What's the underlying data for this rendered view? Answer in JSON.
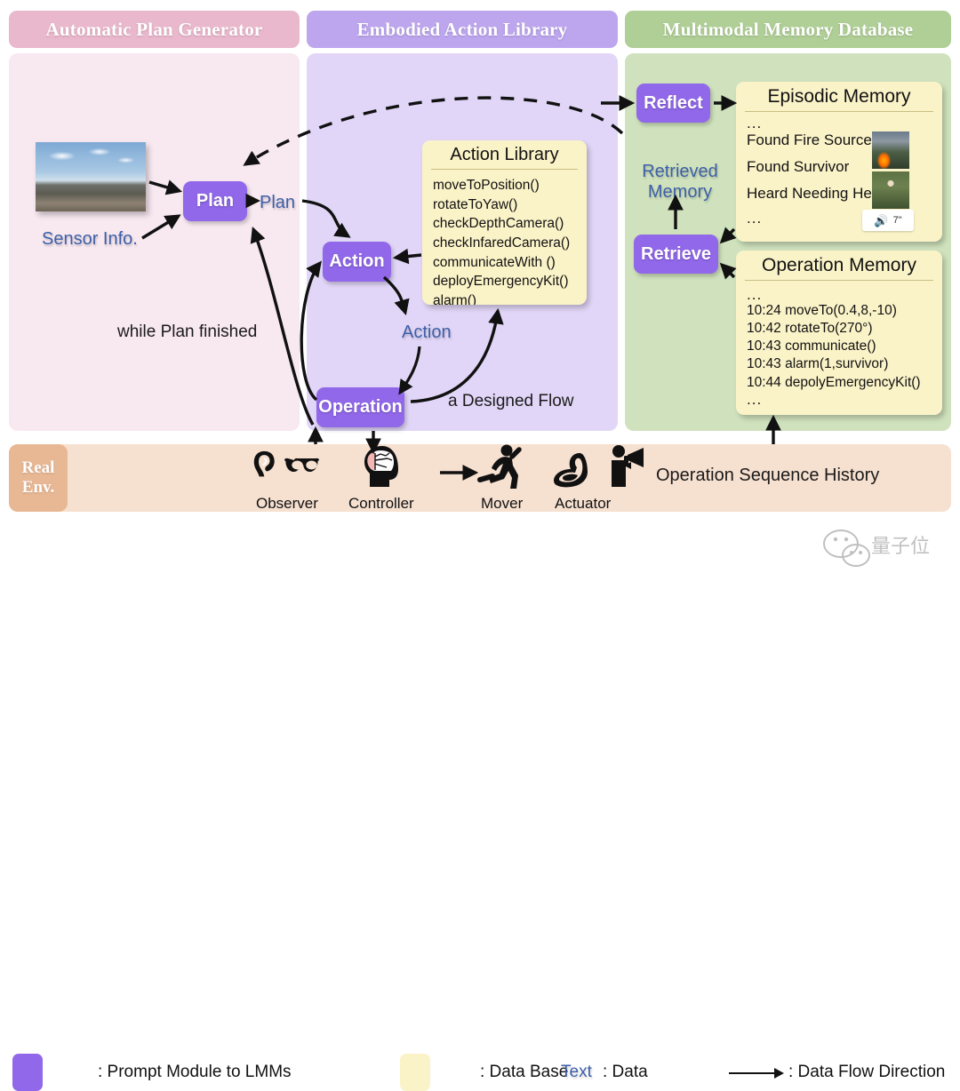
{
  "columns": [
    {
      "title": "Automatic Plan Generator",
      "color": "#eab8cd"
    },
    {
      "title": "Embodied Action Library",
      "color": "#bda6ee"
    },
    {
      "title": "Multimodal Memory Database",
      "color": "#b0cf96"
    }
  ],
  "modules": {
    "plan": "Plan",
    "action": "Action",
    "operation": "Operation",
    "reflect": "Reflect",
    "retrieve": "Retrieve",
    "color": "#9168ea"
  },
  "data_labels": {
    "plan_flow": "Plan",
    "sensor_info": "Sensor Info.",
    "action_flow": "Action",
    "retrieved_memory_line1": "Retrieved",
    "retrieved_memory_line2": "Memory",
    "color": "#3d5fa8"
  },
  "annotations": {
    "while_plan_finished": "while Plan finished",
    "designed_flow": "a Designed Flow",
    "operation_sequence_history": "Operation Sequence History"
  },
  "action_library": {
    "title": "Action Library",
    "items": [
      "moveToPosition()",
      "rotateToYaw()",
      "checkDepthCamera()",
      "checkInfaredCamera()",
      "communicateWith ()",
      "deployEmergencyKit()",
      "alarm()"
    ]
  },
  "episodic_memory": {
    "title": "Episodic Memory",
    "top_ellipsis": "...",
    "bottom_ellipsis": "...",
    "entries": [
      {
        "text": "Found Fire Source",
        "media": "fire-photo"
      },
      {
        "text": "Found Survivor",
        "media": "survivor-photo"
      },
      {
        "text": "Heard Needing Help",
        "media": "audio-clip"
      }
    ],
    "audio_chip": {
      "icon": "speaker-icon",
      "duration": "7\""
    }
  },
  "operation_memory": {
    "title": "Operation Memory",
    "top_ellipsis": "...",
    "bottom_ellipsis": "...",
    "lines": [
      "10:24 moveTo(0.4,8,-10)",
      "10:42 rotateTo(270°)",
      "10:43 communicate()",
      "10:43 alarm(1,survivor)",
      "10:44 depolyEmergencyKit()"
    ]
  },
  "real_env": {
    "tag_line1": "Real",
    "tag_line2": "Env.",
    "roles": [
      {
        "name": "Observer",
        "icons": [
          "ear-icon",
          "glasses-icon"
        ]
      },
      {
        "name": "Controller",
        "icons": [
          "brain-head-icon"
        ]
      },
      {
        "name": "Mover",
        "icons": [
          "running-person-icon"
        ]
      },
      {
        "name": "Actuator",
        "icons": [
          "muscle-arm-icon",
          "megaphone-person-icon"
        ]
      }
    ]
  },
  "legend": {
    "prompt_module": ": Prompt Module to LMMs",
    "data_base": ": Data Base",
    "data_text_sample": "Text",
    "data_text": ": Data",
    "data_flow": ": Data Flow Direction",
    "watermark": "量子位"
  }
}
